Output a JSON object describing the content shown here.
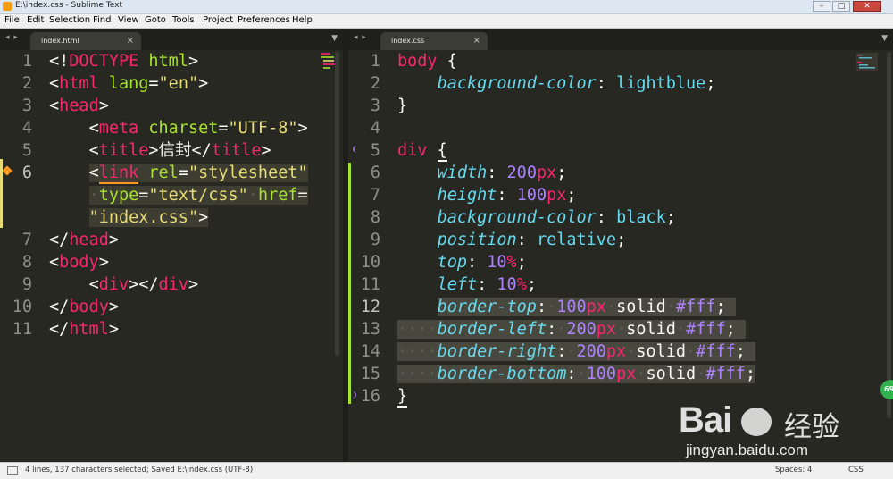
{
  "window": {
    "title": "E:\\index.css - Sublime Text",
    "minimize": "–",
    "maximize": "□",
    "close": "✕"
  },
  "menu": [
    "File",
    "Edit",
    "Selection",
    "Find",
    "View",
    "Goto",
    "Tools",
    "Project",
    "Preferences",
    "Help"
  ],
  "left_pane": {
    "tab_label": "index.html",
    "tab_close": "×",
    "nav": "◂ ▸",
    "panel_menu": "▼",
    "line_numbers": [
      "1",
      "2",
      "3",
      "4",
      "5",
      "6",
      "",
      "",
      "7",
      "8",
      "9",
      "10",
      "11"
    ]
  },
  "right_pane": {
    "tab_label": "index.css",
    "tab_close": "×",
    "nav": "◂ ▸",
    "panel_menu": "▼",
    "line_numbers": [
      "1",
      "2",
      "3",
      "4",
      "5",
      "6",
      "7",
      "8",
      "9",
      "10",
      "11",
      "12",
      "13",
      "14",
      "15",
      "16"
    ]
  },
  "status": {
    "message": "4 lines, 137 characters selected; Saved E:\\index.css (UTF-8)",
    "indent": "Spaces: 4",
    "syntax": "CSS"
  },
  "watermark": {
    "brand": "Bai",
    "brand_cn": "经验",
    "url": "jingyan.baidu.com"
  },
  "badge": "69",
  "colors": {
    "editor_bg": "#272822",
    "tag": "#f92672",
    "attribute": "#a6e22e",
    "string": "#e6db74",
    "property": "#66d9ef",
    "number": "#ae81ff"
  }
}
